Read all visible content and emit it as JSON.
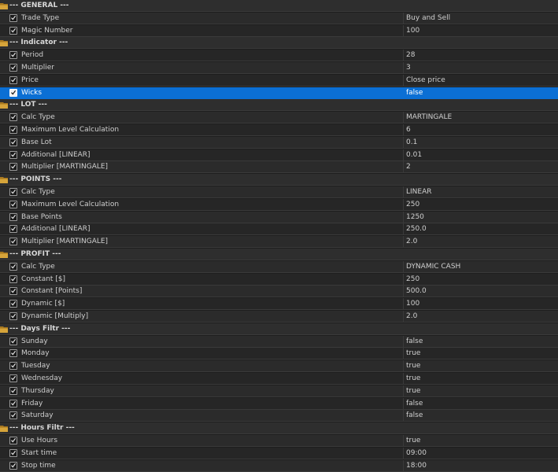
{
  "groups": [
    {
      "title": "--- GENERAL ---",
      "params": [
        {
          "name": "Trade Type",
          "value": "Buy and Sell"
        },
        {
          "name": "Magic Number",
          "value": "100"
        }
      ]
    },
    {
      "title": "--- Indicator ---",
      "params": [
        {
          "name": "Period",
          "value": "28"
        },
        {
          "name": "Multiplier",
          "value": "3"
        },
        {
          "name": "Price",
          "value": "Close price"
        },
        {
          "name": "Wicks",
          "value": "false",
          "selected": true
        }
      ]
    },
    {
      "title": "--- LOT ---",
      "params": [
        {
          "name": "Calc Type",
          "value": "MARTINGALE"
        },
        {
          "name": "Maximum Level Calculation",
          "value": "6"
        },
        {
          "name": "Base Lot",
          "value": "0.1"
        },
        {
          "name": "Additional [LINEAR]",
          "value": "0.01"
        },
        {
          "name": "Multiplier [MARTINGALE]",
          "value": "2"
        }
      ]
    },
    {
      "title": "--- POINTS ---",
      "params": [
        {
          "name": "Calc Type",
          "value": "LINEAR"
        },
        {
          "name": "Maximum Level Calculation",
          "value": "250"
        },
        {
          "name": "Base Points",
          "value": "1250"
        },
        {
          "name": "Additional [LINEAR]",
          "value": "250.0"
        },
        {
          "name": "Multiplier [MARTINGALE]",
          "value": "2.0"
        }
      ]
    },
    {
      "title": "--- PROFIT ---",
      "params": [
        {
          "name": "Calc Type",
          "value": "DYNAMIC CASH"
        },
        {
          "name": "Constant [$]",
          "value": "250"
        },
        {
          "name": "Constant [Points]",
          "value": "500.0"
        },
        {
          "name": "Dynamic [$]",
          "value": "100"
        },
        {
          "name": "Dynamic [Multiply]",
          "value": "2.0"
        }
      ]
    },
    {
      "title": "--- Days Filtr ---",
      "params": [
        {
          "name": "Sunday",
          "value": "false"
        },
        {
          "name": "Monday",
          "value": "true"
        },
        {
          "name": "Tuesday",
          "value": "true"
        },
        {
          "name": "Wednesday",
          "value": "true"
        },
        {
          "name": "Thursday",
          "value": "true"
        },
        {
          "name": "Friday",
          "value": "false"
        },
        {
          "name": "Saturday",
          "value": "false"
        }
      ]
    },
    {
      "title": "--- Hours Filtr ---",
      "params": [
        {
          "name": "Use Hours",
          "value": "true"
        },
        {
          "name": "Start time",
          "value": "09:00"
        },
        {
          "name": "Stop time",
          "value": "18:00"
        }
      ]
    }
  ],
  "icons": {
    "group": "folder-icon",
    "param": "checkbox-checked-icon"
  },
  "colors": {
    "background": "#262626",
    "alt_background": "#2b2b2b",
    "selection": "#0b6fd4",
    "text": "#cfcfcf",
    "folder": "#d6a43a"
  }
}
